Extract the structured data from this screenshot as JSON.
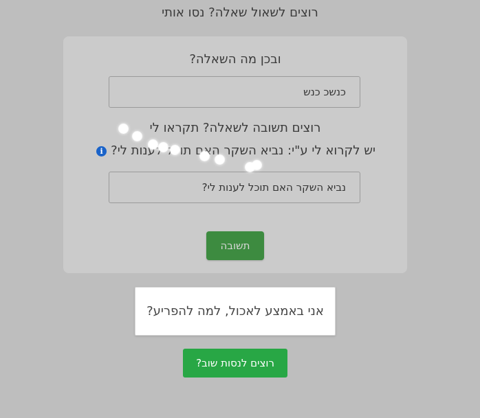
{
  "header": {
    "title": "רוצים לשאול שאלה? נסו אותי"
  },
  "card": {
    "question_label": "ובכן מה השאלה?",
    "question_input_value": "כנשכ כנש",
    "hint_line1": "רוצים תשובה לשאלה? תקראו לי",
    "hint_line2": "יש לקרוא לי ע\"י: נביא השקר האם תוכל לענות לי?",
    "info_icon_glyph": "i",
    "answer_input_value": "נביא השקר האם תוכל לענות לי?",
    "answer_button_label": "תשובה"
  },
  "result": {
    "text": "אני באמצע לאכול, למה להפריע?"
  },
  "retry_button_label": "רוצים לנסות שוב?",
  "colors": {
    "background": "#bebebe",
    "card": "#cbcbcb",
    "answer_button": "#3d8b40",
    "retry_button": "#28a745",
    "info_icon": "#1a63c9"
  }
}
